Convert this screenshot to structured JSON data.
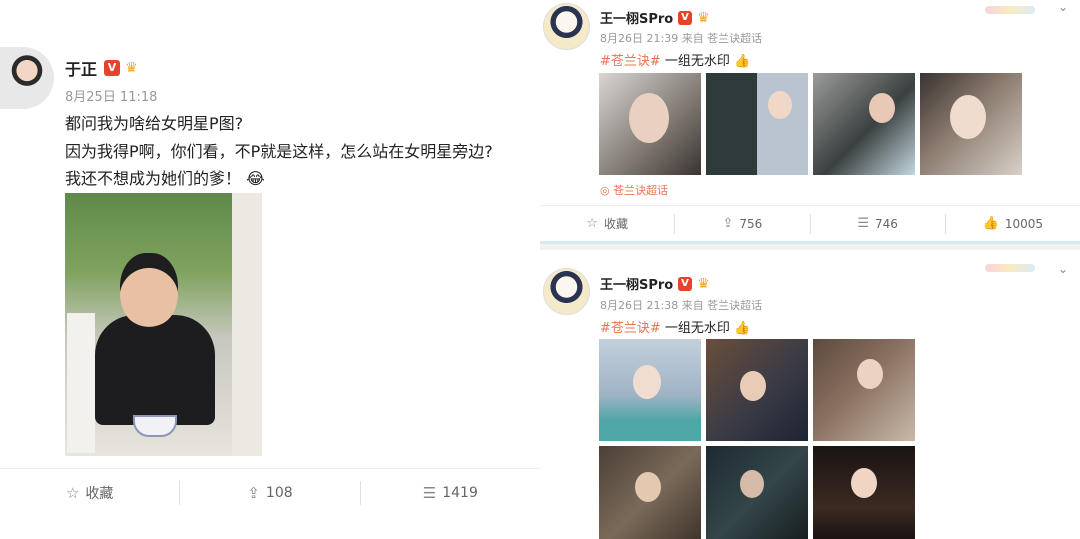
{
  "left_post": {
    "username": "于正",
    "timestamp": "8月25日 11:18",
    "lines": [
      "都问我为啥给女明星P图?",
      "因为我得P啊，你们看，不P就是这样，怎么站在女明星旁边?",
      "我还不想成为她们的爹！"
    ],
    "emoji": "😂",
    "actions": {
      "favorite": "收藏",
      "repost_count": "108",
      "comment_count": "1419"
    }
  },
  "right_posts": [
    {
      "username": "王一栩SPro",
      "timestamp": "8月26日 21:39 来自 苍兰诀超话",
      "hashtag": "#苍兰诀#",
      "text": " 一组无水印",
      "topic_link": "苍兰诀超话",
      "actions": {
        "favorite": "收藏",
        "repost_count": "756",
        "comment_count": "746",
        "like_count": "10005"
      }
    },
    {
      "username": "王一栩SPro",
      "timestamp": "8月26日 21:38 来自 苍兰诀超话",
      "hashtag": "#苍兰诀#",
      "text": " 一组无水印"
    }
  ],
  "icons": {
    "verified": "V",
    "favorite": "☆",
    "repost": "⇪",
    "comment": "☰",
    "like": "👍",
    "chevron": "⌄",
    "topic": "◎"
  },
  "colors": {
    "verified": "#e8412c",
    "hashtag": "#eb7350",
    "divider": "#d5e9f7"
  }
}
